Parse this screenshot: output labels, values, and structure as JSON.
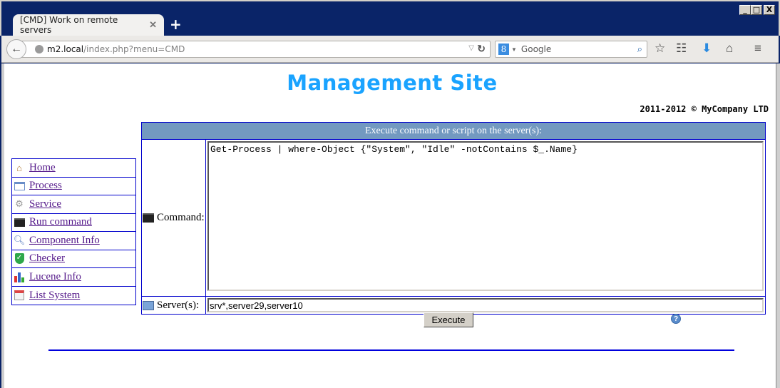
{
  "browser": {
    "tab_title": "[CMD] Work on remote servers",
    "tab_close": "✕",
    "new_tab": "+",
    "url_host": "m2.local",
    "url_path": "/index.php?menu=CMD",
    "search_placeholder": "Google",
    "search_engine_glyph": "8",
    "window_buttons": {
      "minimize": "_",
      "maximize": "□",
      "close": "X"
    },
    "toolbar_icons": [
      "star-icon",
      "reading-list-icon",
      "download-icon",
      "home-icon",
      "menu-icon"
    ]
  },
  "site": {
    "title": "Management Site",
    "copyright": "2011-2012 © MyCompany LTD"
  },
  "menu": {
    "items": [
      {
        "label": "Home",
        "icon": "home-icon"
      },
      {
        "label": "Process",
        "icon": "window-icon"
      },
      {
        "label": "Service",
        "icon": "gear-icon"
      },
      {
        "label": "Run command",
        "icon": "console-icon"
      },
      {
        "label": "Component Info",
        "icon": "magnifier-icon"
      },
      {
        "label": "Checker",
        "icon": "shield-check-icon"
      },
      {
        "label": "Lucene Info",
        "icon": "bar-chart-icon"
      },
      {
        "label": "List System",
        "icon": "calendar-icon"
      }
    ]
  },
  "command_panel": {
    "header": "Execute command or script on the server(s):",
    "command_label": "Command:",
    "command_value": "Get-Process | where-Object {\"System\", \"Idle\" -notContains $_.Name}",
    "servers_label": "Server(s):",
    "servers_value": "srv*,server29,server10",
    "execute_label": "Execute",
    "help_glyph": "?"
  },
  "colors": {
    "title_blue": "#1aa3ff",
    "header_bg": "#7399c0",
    "border_blue": "#0000cc",
    "link_visited": "#551a8b"
  }
}
